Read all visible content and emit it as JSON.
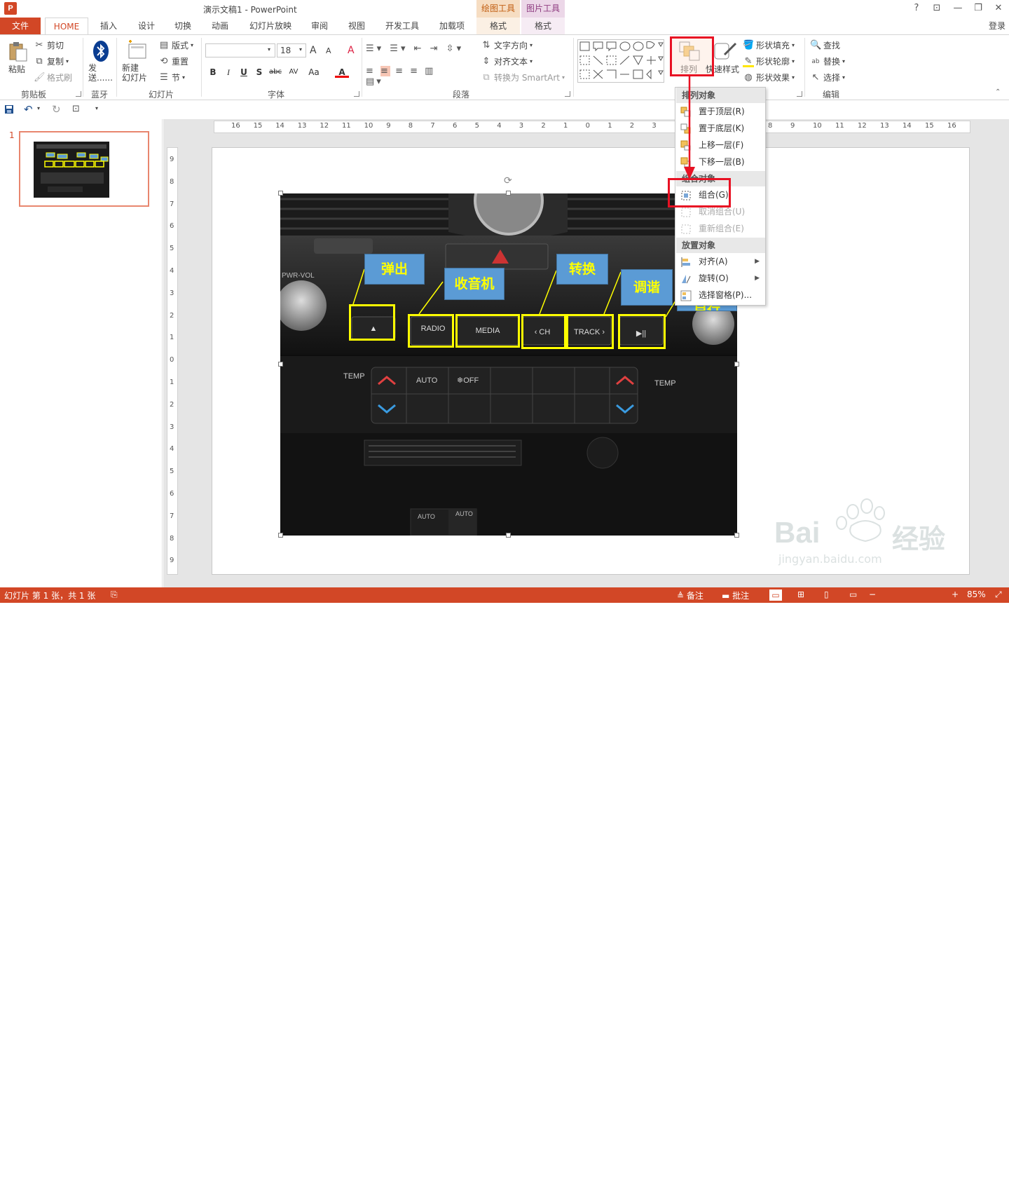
{
  "window": {
    "title": "演示文稿1 - PowerPoint",
    "app_icon": "P",
    "help": "?",
    "restore_ribbon": "⊡",
    "minimize": "—",
    "maximize": "❐",
    "close": "✕",
    "context_groups": [
      {
        "name": "绘图工具",
        "tab": "格式",
        "color": "#e8a35b"
      },
      {
        "name": "图片工具",
        "tab": "格式",
        "color": "#b05fa3"
      }
    ],
    "login": "登录"
  },
  "tabs": {
    "file": "文件",
    "items": [
      "HOME",
      "插入",
      "设计",
      "切换",
      "动画",
      "幻灯片放映",
      "审阅",
      "视图",
      "开发工具",
      "加载项"
    ]
  },
  "ribbon": {
    "clipboard": {
      "label": "剪贴板",
      "paste": "粘贴",
      "cut": "剪切",
      "copy": "复制",
      "format_painter": "格式刷"
    },
    "bluetooth": {
      "label": "蓝牙",
      "send": "发\n送......"
    },
    "slides": {
      "label": "幻灯片",
      "new_slide": "新建\n幻灯片",
      "layout": "版式",
      "reset": "重置",
      "section": "节"
    },
    "font": {
      "label": "字体",
      "font_name": "",
      "font_size": "18",
      "grow": "A",
      "shrink": "A",
      "clear": "A",
      "bold": "B",
      "italic": "I",
      "underline": "U",
      "shadow": "S",
      "strike": "abc",
      "spacing": "AV",
      "case": "Aa",
      "color": "A"
    },
    "paragraph": {
      "label": "段落",
      "text_direction": "文字方向",
      "align_text": "对齐文本",
      "smartart": "转换为 SmartArt"
    },
    "drawing": {
      "arrange": "排列",
      "quick_styles": "快速样式",
      "shape_fill": "形状填充",
      "shape_outline": "形状轮廓",
      "shape_effects": "形状效果"
    },
    "editing": {
      "label": "编辑",
      "find": "查找",
      "replace": "替换",
      "select": "选择"
    }
  },
  "dropdown_menu": {
    "section_order": "排列对象",
    "bring_to_front": "置于顶层(R)",
    "send_to_back": "置于底层(K)",
    "bring_forward": "上移一层(F)",
    "send_backward": "下移一层(B)",
    "section_group": "组合对象",
    "group": "组合(G)",
    "ungroup": "取消组合(U)",
    "regroup": "重新组合(E)",
    "section_position": "放置对象",
    "align": "对齐(A)",
    "rotate": "旋转(O)",
    "selection_pane": "选择窗格(P)..."
  },
  "thumbnail": {
    "slide_number": "1"
  },
  "ruler": {
    "h_ticks": [
      "16",
      "15",
      "14",
      "13",
      "12",
      "11",
      "10",
      "9",
      "8",
      "7",
      "6",
      "5",
      "4",
      "3",
      "2",
      "1",
      "0",
      "1",
      "2",
      "3",
      "8",
      "9",
      "10",
      "11",
      "12",
      "13",
      "14",
      "15",
      "16"
    ],
    "v_ticks": [
      "9",
      "8",
      "7",
      "6",
      "5",
      "4",
      "3",
      "2",
      "1",
      "0",
      "1",
      "2",
      "3",
      "4",
      "5",
      "6",
      "7",
      "8",
      "9"
    ]
  },
  "slide": {
    "labels": [
      "弹出",
      "收音机",
      "转换",
      "调谐",
      "自行"
    ],
    "car_buttons": [
      "▲",
      "RADIO",
      "MEDIA",
      "‹ CH",
      "TRACK ›",
      "▶||"
    ],
    "car_text": [
      "PWR-VOL",
      "TEMP",
      "AUTO",
      "❄OFF",
      "TEMP",
      "AUTO",
      "AUTO"
    ]
  },
  "statusbar": {
    "slide_info": "幻灯片 第 1 张，共 1 张",
    "notes": "备注",
    "comments": "批注",
    "zoom": "85%"
  },
  "watermark": {
    "brand": "Bai",
    "brand_cn": "经验",
    "url": "jingyan.baidu.com"
  }
}
